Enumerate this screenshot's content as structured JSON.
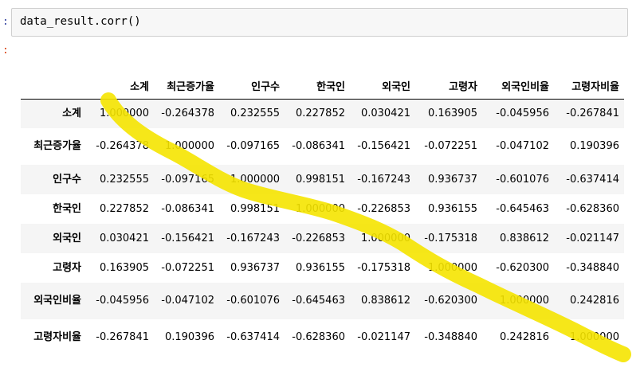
{
  "prompts": {
    "input": ":",
    "output": ":"
  },
  "code_cell": {
    "code": "data_result.corr()"
  },
  "table": {
    "columns": [
      "소계",
      "최근증가율",
      "인구수",
      "한국인",
      "외국인",
      "고령자",
      "외국인비율",
      "고령자비율"
    ],
    "rows": [
      {
        "label": "소계",
        "values": [
          "1.000000",
          "-0.264378",
          "0.232555",
          "0.227852",
          "0.030421",
          "0.163905",
          "-0.045956",
          "-0.267841"
        ]
      },
      {
        "label": "최근증가율",
        "values": [
          "-0.264378",
          "1.000000",
          "-0.097165",
          "-0.086341",
          "-0.156421",
          "-0.072251",
          "-0.047102",
          "0.190396"
        ]
      },
      {
        "label": "인구수",
        "values": [
          "0.232555",
          "-0.097165",
          "1.000000",
          "0.998151",
          "-0.167243",
          "0.936737",
          "-0.601076",
          "-0.637414"
        ]
      },
      {
        "label": "한국인",
        "values": [
          "0.227852",
          "-0.086341",
          "0.998151",
          "1.000000",
          "-0.226853",
          "0.936155",
          "-0.645463",
          "-0.628360"
        ]
      },
      {
        "label": "외국인",
        "values": [
          "0.030421",
          "-0.156421",
          "-0.167243",
          "-0.226853",
          "1.000000",
          "-0.175318",
          "0.838612",
          "-0.021147"
        ]
      },
      {
        "label": "고령자",
        "values": [
          "0.163905",
          "-0.072251",
          "0.936737",
          "0.936155",
          "-0.175318",
          "1.000000",
          "-0.620300",
          "-0.348840"
        ]
      },
      {
        "label": "외국인비율",
        "values": [
          "-0.045956",
          "-0.047102",
          "-0.601076",
          "-0.645463",
          "0.838612",
          "-0.620300",
          "1.000000",
          "0.242816"
        ]
      },
      {
        "label": "고령자비율",
        "values": [
          "-0.267841",
          "0.190396",
          "-0.637414",
          "-0.628360",
          "-0.021147",
          "-0.348840",
          "0.242816",
          "1.000000"
        ]
      }
    ]
  },
  "annotation": {
    "color": "#f5e400"
  }
}
